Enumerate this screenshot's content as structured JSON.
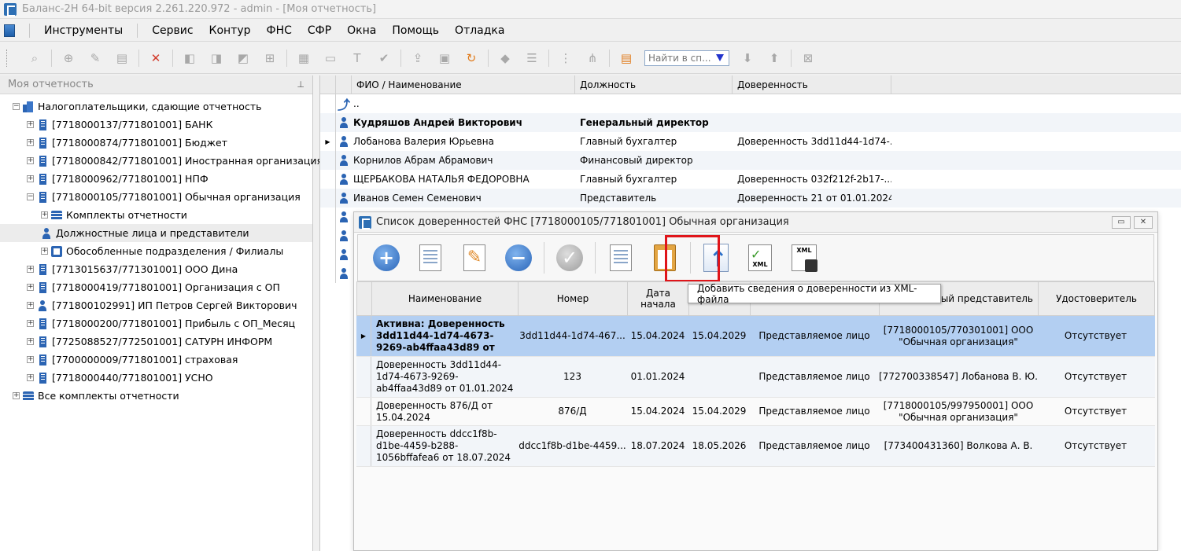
{
  "window": {
    "title": "Баланс-2Н 64-bit версия 2.261.220.972 - admin - [Моя отчетность]"
  },
  "menu": [
    "Инструменты",
    "Сервис",
    "Контур",
    "ФНС",
    "СФР",
    "Окна",
    "Помощь",
    "Отладка"
  ],
  "toolbar": {
    "search_placeholder": "Найти в сп..."
  },
  "left_panel": {
    "title": "Моя отчетность",
    "tree": [
      {
        "label": "Налогоплательщики, сдающие отчетность",
        "level": 0,
        "icon": "buildings-icon",
        "expanded": true
      },
      {
        "label": "[7718000137/771801001] БАНК",
        "level": 1,
        "icon": "building-icon"
      },
      {
        "label": "[7718000874/771801001] Бюджет",
        "level": 1,
        "icon": "building-icon"
      },
      {
        "label": "[7718000842/771801001] Иностранная организация",
        "level": 1,
        "icon": "building-icon"
      },
      {
        "label": "[7718000962/771801001] НПФ",
        "level": 1,
        "icon": "building-icon"
      },
      {
        "label": "[7718000105/771801001] Обычная организация",
        "level": 1,
        "icon": "building-icon",
        "expanded": true
      },
      {
        "label": "Комплекты отчетности",
        "level": 2,
        "icon": "stack-icon"
      },
      {
        "label": "Должностные лица и представители",
        "level": 2,
        "icon": "person-icon",
        "selected": true
      },
      {
        "label": "Обособленные подразделения / Филиалы",
        "level": 2,
        "icon": "branch-icon"
      },
      {
        "label": "[7713015637/771301001] ООО Дина",
        "level": 1,
        "icon": "building-icon"
      },
      {
        "label": "[7718000419/771801001] Организация с ОП",
        "level": 1,
        "icon": "building-icon"
      },
      {
        "label": "[771800102991] ИП Петров Сергей Викторович",
        "level": 1,
        "icon": "person-icon"
      },
      {
        "label": "[7718000200/771801001] Прибыль с ОП_Месяц",
        "level": 1,
        "icon": "building-icon"
      },
      {
        "label": "[7725088527/772501001] САТУРН ИНФОРМ",
        "level": 1,
        "icon": "building-icon"
      },
      {
        "label": "[7700000009/771801001] страховая",
        "level": 1,
        "icon": "building-icon"
      },
      {
        "label": "[7718000440/771801001] УСНО",
        "level": 1,
        "icon": "building-icon"
      },
      {
        "label": "Все комплекты отчетности",
        "level": 0,
        "icon": "stack-icon"
      }
    ]
  },
  "main_grid": {
    "headers": [
      "ФИО / Наименование",
      "Должность",
      "Доверенность"
    ],
    "up_row": "..",
    "rows": [
      {
        "name": "Кудряшов Андрей Викторович",
        "position": "Генеральный директор",
        "poa": "",
        "bold": true
      },
      {
        "name": "Лобанова Валерия Юрьевна",
        "position": "Главный бухгалтер",
        "poa": "Доверенность 3dd11d44-1d74-...",
        "current": true
      },
      {
        "name": "Корнилов Абрам Абрамович",
        "position": "Финансовый директор",
        "poa": ""
      },
      {
        "name": "ЩЕРБАКОВА НАТАЛЬЯ ФЕДОРОВНА",
        "position": "Главный бухгалтер",
        "poa": "Доверенность 032f212f-2b17-..."
      },
      {
        "name": "Иванов Семен Семенович",
        "position": "Представитель",
        "poa": "Доверенность 21 от 01.01.2024"
      }
    ]
  },
  "modal": {
    "title": "Список доверенностей ФНС [7718000105/771801001] Обычная организация",
    "tooltip": "Добавить сведения о доверенности из XML-файла",
    "xml_label": "XML",
    "headers": {
      "name": "Наименование",
      "number": "Номер",
      "start": "Дата начала",
      "representative": "...ный представитель",
      "certifier": "Удостоверитель"
    },
    "rows": [
      {
        "name": "Активна: Доверенность 3dd11d44-1d74-4673-9269-ab4ffaa43d89 от",
        "number": "3dd11d44-1d74-467...",
        "start": "15.04.2024",
        "end": "15.04.2029",
        "kind": "Представляемое лицо",
        "representative": "[7718000105/770301001] ООО \"Обычная организация\"",
        "certifier": "Отсутствует",
        "selected": true
      },
      {
        "name": "Доверенность 3dd11d44-1d74-4673-9269-ab4ffaa43d89 от 01.01.2024",
        "number": "123",
        "start": "01.01.2024",
        "end": "",
        "kind": "Представляемое лицо",
        "representative": "[772700338547] Лобанова В. Ю.",
        "certifier": "Отсутствует"
      },
      {
        "name": "Доверенность 876/Д от 15.04.2024",
        "number": "876/Д",
        "start": "15.04.2024",
        "end": "15.04.2029",
        "kind": "Представляемое лицо",
        "representative": "[7718000105/997950001] ООО \"Обычная организация\"",
        "certifier": "Отсутствует"
      },
      {
        "name": "Доверенность ddcc1f8b-d1be-4459-b288-1056bffafea6 от 18.07.2024",
        "number": "ddcc1f8b-d1be-4459...",
        "start": "18.07.2024",
        "end": "18.05.2026",
        "kind": "Представляемое лицо",
        "representative": "[773400431360] Волкова А. В.",
        "certifier": "Отсутствует"
      }
    ]
  },
  "colors": {
    "accent_blue": "#2b64b3",
    "selection": "#b3cff2",
    "highlight_red": "#e0151a"
  }
}
